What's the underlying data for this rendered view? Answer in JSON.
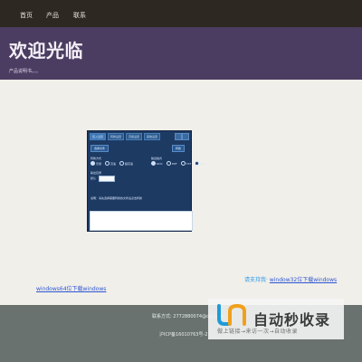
{
  "nav": {
    "items": [
      "首页",
      "产品",
      "联系"
    ]
  },
  "hero": {
    "title": "欢迎光临",
    "subtitle": "产品说明书。。。"
  },
  "app": {
    "tabs": [
      "接入设置",
      "转换设置",
      "高级设置",
      "其他设置"
    ],
    "row1": {
      "left_button": "选择文件",
      "right_button": "转换"
    },
    "group1": {
      "title": "转换方式",
      "options": [
        "普通",
        "高速",
        "超高速"
      ],
      "selected_index": 0
    },
    "group2": {
      "title": "输出格式",
      "options": [
        "DOC",
        "PDF",
        "TXT",
        "JPG"
      ],
      "selected_index": 0
    },
    "select": {
      "label": "输出目录",
      "value": "默认"
    },
    "note": "说明：请先选择需要转换的文件后点击转换"
  },
  "links": {
    "row1_prefix": "请支持我·",
    "row1_link": "window32位下载windows",
    "row2_link": "windows64位下载windows"
  },
  "footer": {
    "contact": "联系方式: 2772880074@qq.com",
    "icp": "沪ICP备16010763号-2"
  },
  "watermark": {
    "title": "自动秒收录",
    "sub": "做上链接→来访一次→自动收录"
  },
  "colors": {
    "nav_bg": "#2d2822",
    "hero_bg": "#4b3d61",
    "page_bg": "#f1efe9",
    "footer_bg": "#6a726f",
    "link": "#2d56d3"
  }
}
